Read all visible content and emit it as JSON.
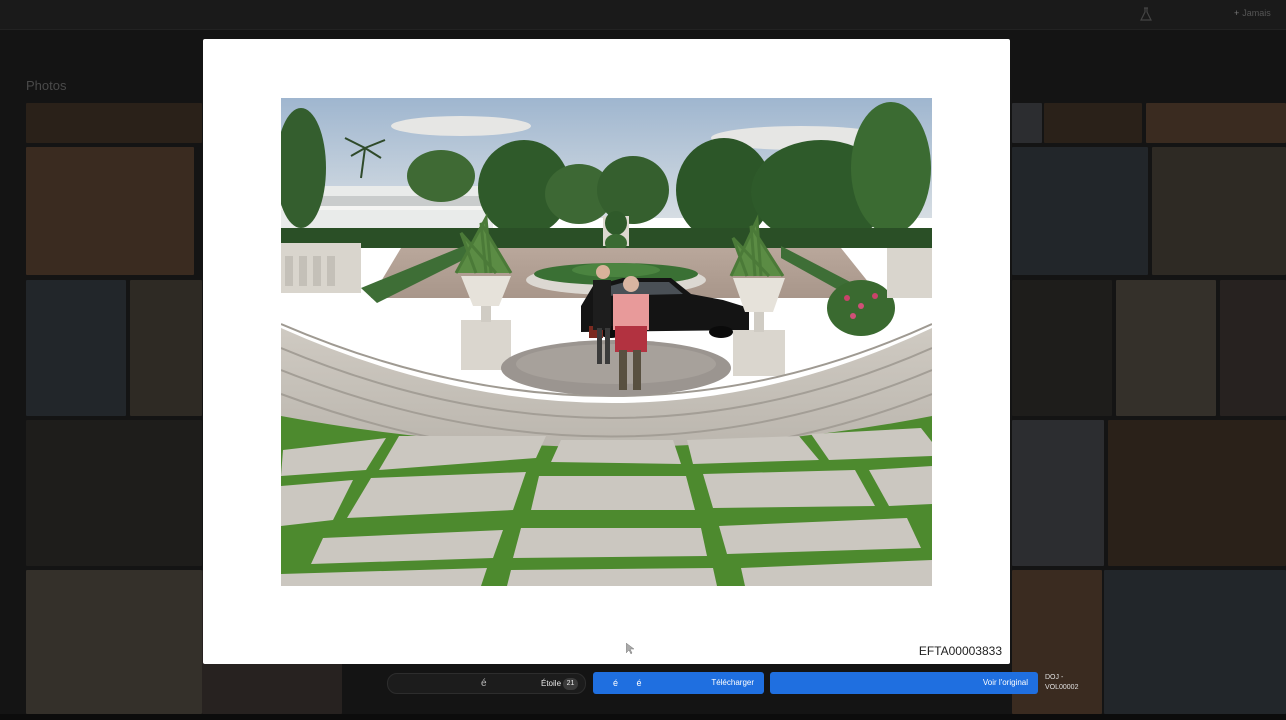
{
  "background": {
    "app_title": "",
    "breadcrumb": "",
    "section_title": "Photos",
    "section_subtitle": "",
    "sort_label": "",
    "user_link": "Jamais",
    "thumb_colors": [
      "#2a2119",
      "#3a2b20",
      "#22262a",
      "#2e2a24",
      "#1e1d1b",
      "#34302a",
      "#272220",
      "#2c2d30"
    ]
  },
  "lightbox": {
    "document_id": "EFTA00003833"
  },
  "actions": {
    "star_glyph": "é",
    "star_label": "Étoile",
    "star_count": "21",
    "download_glyphs": "é é",
    "download_label": "Télécharger",
    "original_label": "Voir l'original",
    "volume_line1": "DOJ -",
    "volume_line2": "VOL00002"
  },
  "colors": {
    "accent": "#1f6fe0",
    "overlay_background": "#141414",
    "lightbox_background": "#ffffff"
  },
  "icons": [
    "flask-icon",
    "plus-icon",
    "cursor-icon"
  ]
}
